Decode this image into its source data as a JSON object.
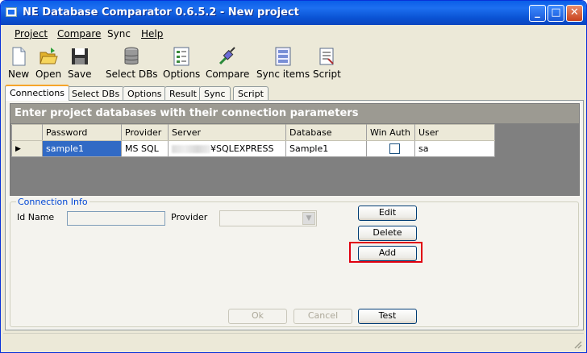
{
  "window": {
    "title": "NE Database Comparator 0.6.5.2 - New project"
  },
  "menu": {
    "project": "Project",
    "compare": "Compare",
    "sync": "Sync",
    "help": "Help"
  },
  "toolbar": {
    "new": "New",
    "open": "Open",
    "save": "Save",
    "select_dbs": "Select DBs",
    "options": "Options",
    "compare": "Compare",
    "sync_items": "Sync items",
    "script": "Script"
  },
  "tabs": [
    "Connections",
    "Select DBs",
    "Options",
    "Result",
    "Sync",
    "Script"
  ],
  "grid": {
    "caption": "Enter project databases with their connection parameters",
    "columns": [
      "Password",
      "Provider",
      "Server",
      "Database",
      "Win Auth",
      "User"
    ],
    "rows": [
      {
        "indicator": "▶",
        "password": "sample1",
        "provider": "MS SQL",
        "server": "¥SQLEXPRESS",
        "database": "Sample1",
        "win_auth": false,
        "user": "sa"
      }
    ]
  },
  "connection_info": {
    "legend": "Connection Info",
    "id_name_label": "Id Name",
    "id_name_value": "",
    "provider_label": "Provider",
    "provider_value": ""
  },
  "buttons": {
    "edit": "Edit",
    "delete": "Delete",
    "add": "Add",
    "ok": "Ok",
    "cancel": "Cancel",
    "test": "Test"
  },
  "window_controls": {
    "minimize": "_",
    "maximize": "□",
    "close": "✕"
  }
}
